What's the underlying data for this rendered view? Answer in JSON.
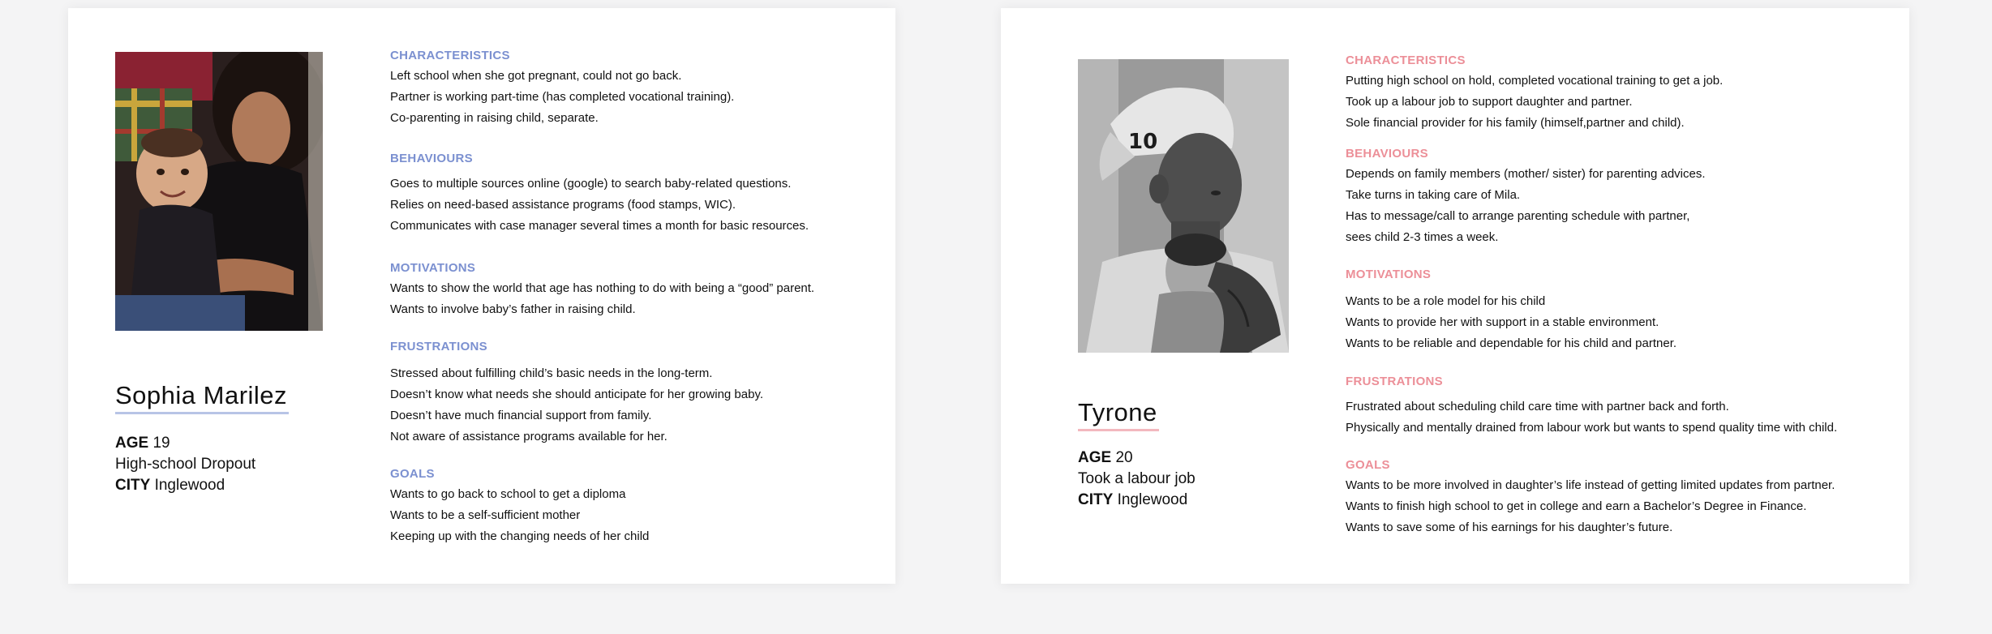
{
  "personas": [
    {
      "name": "Sophia Marilez",
      "age_label": "AGE",
      "age": "19",
      "occupation": "High-school Dropout",
      "city_label": "CITY",
      "city": "Inglewood",
      "sections": [
        {
          "title": "CHARACTERISTICS",
          "lines": [
            "Left school when she got pregnant, could not go back.",
            "Partner is working part-time  (has completed vocational training).",
            "Co-parenting in raising child, separate."
          ]
        },
        {
          "title": "BEHAVIOURS",
          "lines": [
            "Goes to multiple sources online (google) to search baby-related questions.",
            "Relies on need-based assistance programs (food stamps, WIC).",
            "Communicates with case manager several times a month for basic resources."
          ]
        },
        {
          "title": "MOTIVATIONS",
          "lines": [
            "Wants to show the world that age has nothing to do with being a “good” parent.",
            "Wants to involve baby’s father in raising child."
          ]
        },
        {
          "title": "FRUSTRATIONS",
          "lines": [
            "Stressed about fulfilling child’s basic needs in the long-term.",
            "Doesn’t know what needs she should anticipate for her growing baby.",
            "Doesn’t have much financial support from family.",
            "Not aware of assistance programs available for her."
          ]
        },
        {
          "title": "GOALS",
          "lines": [
            "Wants to go back to school to get a diploma",
            "Wants to be a self-sufficient mother",
            "Keeping up with the changing needs of her child"
          ]
        }
      ]
    },
    {
      "name": "Tyrone",
      "age_label": "AGE",
      "age": "20",
      "occupation": "Took a labour job",
      "city_label": "CITY",
      "city": "Inglewood",
      "sections": [
        {
          "title": "CHARACTERISTICS",
          "lines": [
            "Putting high school on hold, completed vocational training to get a job.",
            "Took up a labour job to support daughter and partner.",
            "Sole financial provider for his family (himself,partner and child)."
          ]
        },
        {
          "title": "BEHAVIOURS",
          "lines": [
            "Depends on family members (mother/ sister) for parenting advices.",
            "Take turns in taking care of Mila.",
            "Has to message/call to arrange parenting schedule with partner,",
            "sees child 2-3 times a week."
          ]
        },
        {
          "title": "MOTIVATIONS",
          "lines": [
            "Wants to be a role model for his child",
            "Wants to provide her with support in a stable environment.",
            "Wants to be reliable and dependable for his child and partner."
          ]
        },
        {
          "title": "FRUSTRATIONS",
          "lines": [
            "Frustrated about scheduling child care time with partner back and forth.",
            "Physically and mentally drained from labour work but wants to spend quality time with child."
          ]
        },
        {
          "title": "GOALS",
          "lines": [
            "Wants to be more involved in daughter’s life instead of getting limited updates from partner.",
            "Wants to finish high school to get in college and earn a Bachelor’s Degree in Finance.",
            "Wants to save some of his earnings for his daughter’s future."
          ]
        }
      ]
    }
  ],
  "accent_colors": {
    "sophia": "#7b90d0",
    "tyrone": "#ec8f98"
  }
}
